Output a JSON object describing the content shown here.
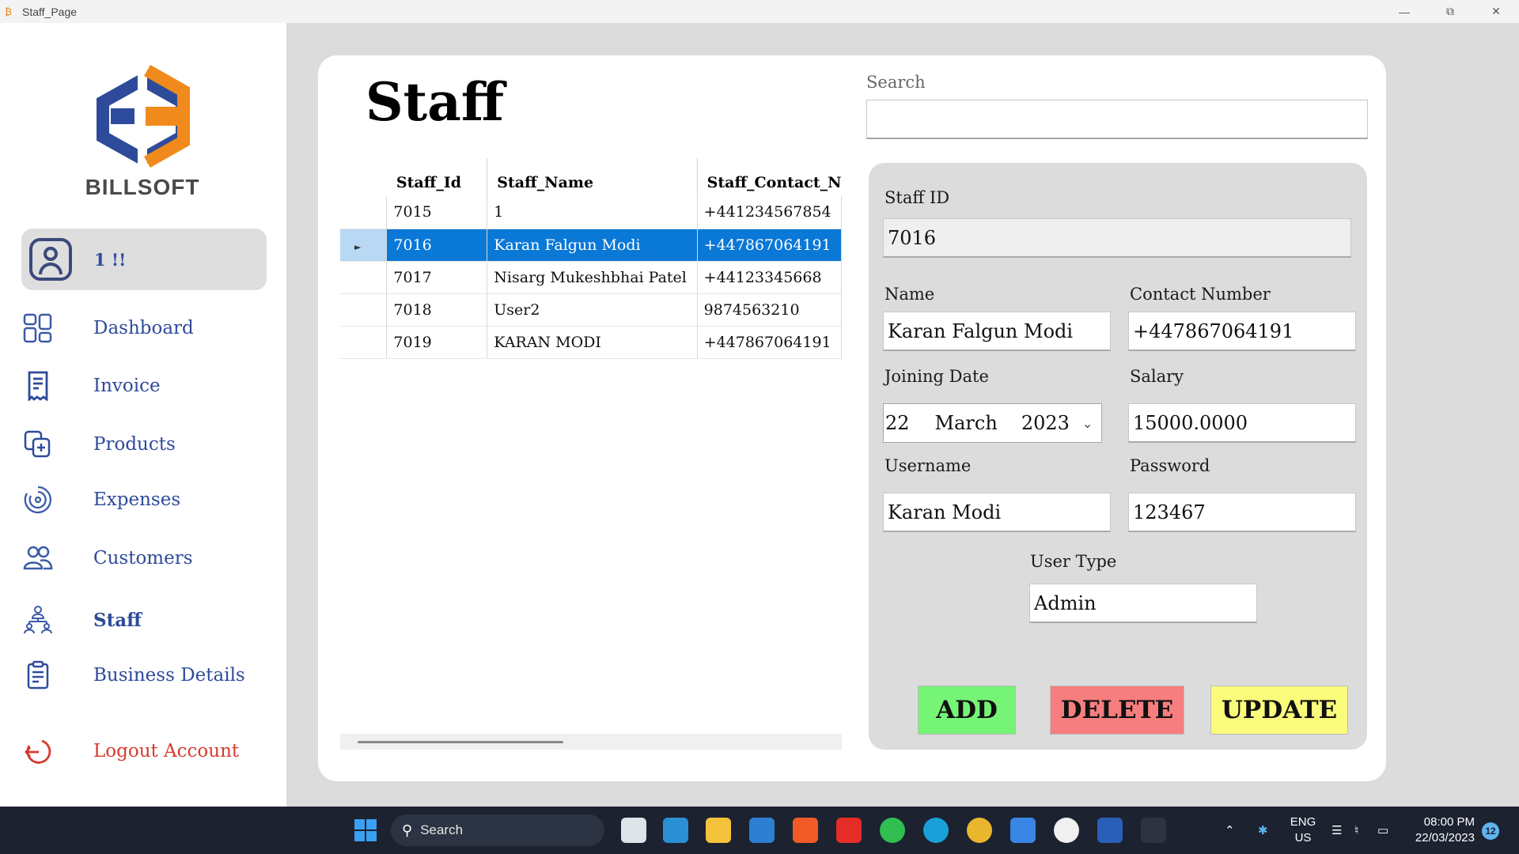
{
  "window": {
    "title": "Staff_Page"
  },
  "sidebar": {
    "brand": "BILLSOFT",
    "user_name": "1 !!",
    "items": [
      {
        "label": "Dashboard",
        "icon": "dashboard-icon"
      },
      {
        "label": "Invoice",
        "icon": "invoice-icon"
      },
      {
        "label": "Products",
        "icon": "products-icon"
      },
      {
        "label": "Expenses",
        "icon": "expenses-icon"
      },
      {
        "label": "Customers",
        "icon": "customers-icon"
      },
      {
        "label": "Staff",
        "icon": "staff-icon",
        "active": true
      },
      {
        "label": "Business Details",
        "icon": "business-details-icon"
      }
    ],
    "logout": "Logout Account"
  },
  "main": {
    "title": "Staff",
    "search": {
      "label": "Search",
      "value": ""
    },
    "grid": {
      "columns": [
        "Staff_Id",
        "Staff_Name",
        "Staff_Contact_N"
      ],
      "rows": [
        {
          "id": "7015",
          "name": "1",
          "contact": "+441234567854"
        },
        {
          "id": "7016",
          "name": "Karan Falgun Modi",
          "contact": "+447867064191",
          "selected": true
        },
        {
          "id": "7017",
          "name": "Nisarg Mukeshbhai Patel",
          "contact": "+44123345668"
        },
        {
          "id": "7018",
          "name": "User2",
          "contact": "9874563210"
        },
        {
          "id": "7019",
          "name": "KARAN MODI",
          "contact": "+447867064191"
        }
      ]
    },
    "form": {
      "staff_id_label": "Staff ID",
      "staff_id": "7016",
      "name_label": "Name",
      "name": "Karan Falgun Modi",
      "contact_label": "Contact Number",
      "contact": "+447867064191",
      "joining_date_label": "Joining Date",
      "joining_day": "22",
      "joining_month": "March",
      "joining_year": "2023",
      "salary_label": "Salary",
      "salary": "15000.0000",
      "username_label": "Username",
      "username": "Karan Modi",
      "password_label": "Password",
      "password": "123467",
      "user_type_label": "User Type",
      "user_type": "Admin",
      "add_label": "ADD",
      "delete_label": "DELETE",
      "update_label": "UPDATE"
    },
    "colors": {
      "add": "#76f476",
      "delete": "#f77e7e",
      "update": "#fbfb7c",
      "accent": "#2e4b9b",
      "selection": "#0a78d7"
    }
  },
  "taskbar": {
    "search_label": "Search",
    "lang_top": "ENG",
    "lang_bottom": "US",
    "time": "08:00 PM",
    "date": "22/03/2023",
    "notifications": "12"
  }
}
